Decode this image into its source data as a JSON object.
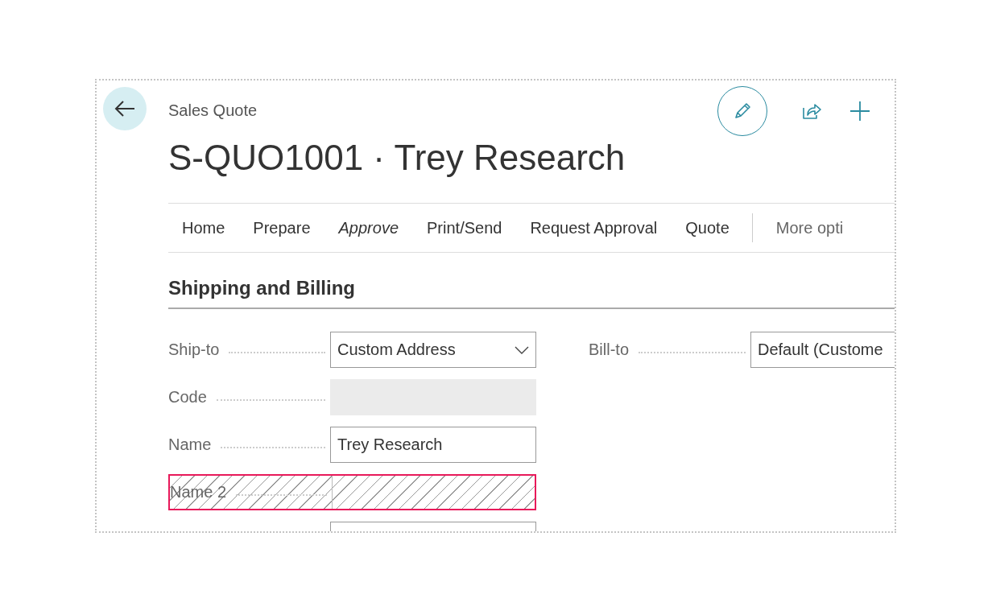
{
  "header": {
    "caption": "Sales Quote",
    "title": "S-QUO1001 · Trey Research"
  },
  "action_bar": {
    "items": [
      {
        "label": "Home",
        "italic": false
      },
      {
        "label": "Prepare",
        "italic": false
      },
      {
        "label": "Approve",
        "italic": true
      },
      {
        "label": "Print/Send",
        "italic": false
      },
      {
        "label": "Request Approval",
        "italic": false
      },
      {
        "label": "Quote",
        "italic": false
      }
    ],
    "more": "More opti"
  },
  "section": {
    "title": "Shipping and Billing"
  },
  "left_fields": [
    {
      "label": "Ship-to",
      "kind": "dropdown",
      "value": "Custom Address",
      "disabled": false,
      "highlighted": false
    },
    {
      "label": "Code",
      "kind": "text",
      "disabled": true,
      "highlighted": false
    },
    {
      "label": "Name",
      "kind": "text",
      "value": "Trey Research",
      "disabled": false,
      "highlighted": false
    },
    {
      "label": "Name 2",
      "kind": "text",
      "disabled": false,
      "highlighted": true
    },
    {
      "kind": "text",
      "disabled": false,
      "highlighted": false
    }
  ],
  "right_fields": [
    {
      "label": "Bill-to",
      "kind": "text",
      "value": "Default (Custome",
      "disabled": false,
      "highlighted": false
    }
  ]
}
